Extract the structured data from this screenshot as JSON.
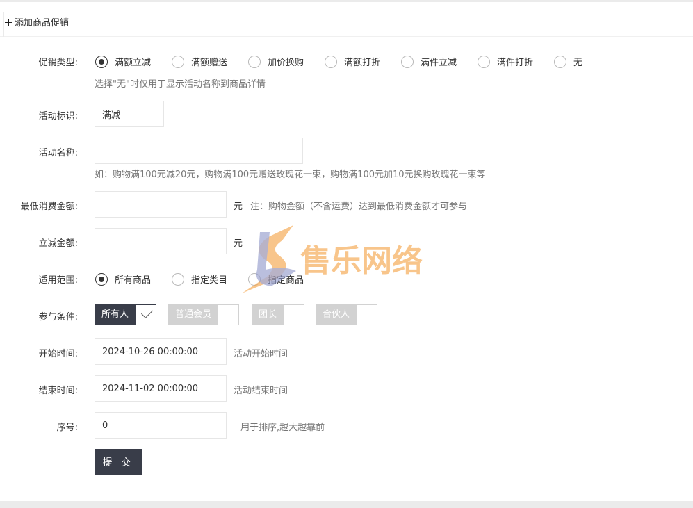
{
  "header": {
    "title": "添加商品促销"
  },
  "form": {
    "promo_type": {
      "label": "促销类型:",
      "options": [
        "满额立减",
        "满额赠送",
        "加价换购",
        "满额打折",
        "满件立减",
        "满件打折",
        "无"
      ],
      "selected": "满额立减",
      "hint": "选择\"无\"时仅用于显示活动名称到商品详情"
    },
    "tag": {
      "label": "活动标识:",
      "value": "满减"
    },
    "name": {
      "label": "活动名称:",
      "value": "",
      "hint": "如：购物满100元减20元，购物满100元赠送玫瑰花一束，购物满100元加10元换购玫瑰花一束等"
    },
    "min_amount": {
      "label": "最低消费金额:",
      "value": "",
      "unit": "元",
      "hint": "注：购物金额（不含运费）达到最低消费金额才可参与"
    },
    "discount": {
      "label": "立减金额:",
      "value": "",
      "unit": "元"
    },
    "scope": {
      "label": "适用范围:",
      "options": [
        "所有商品",
        "指定类目",
        "指定商品"
      ],
      "selected": "所有商品"
    },
    "conditions": {
      "label": "参与条件:",
      "options": [
        "所有人",
        "普通会员",
        "团长",
        "合伙人"
      ],
      "checked": [
        "所有人"
      ]
    },
    "start_time": {
      "label": "开始时间:",
      "value": "2024-10-26 00:00:00",
      "hint": "活动开始时间"
    },
    "end_time": {
      "label": "结束时间:",
      "value": "2024-11-02 00:00:00",
      "hint": "活动结束时间"
    },
    "order": {
      "label": "序号:",
      "value": "0",
      "hint": "用于排序,越大越靠前"
    },
    "submit_label": "提 交"
  },
  "watermark": {
    "text": "售乐网络"
  },
  "colors": {
    "primary_dark": "#393d49",
    "unchecked_gray": "#d2d2d2",
    "watermark_orange": "#f5a54a",
    "watermark_blue": "#8c95c8"
  },
  "icons": {
    "header": "plus-icon",
    "checked": "check-icon"
  }
}
